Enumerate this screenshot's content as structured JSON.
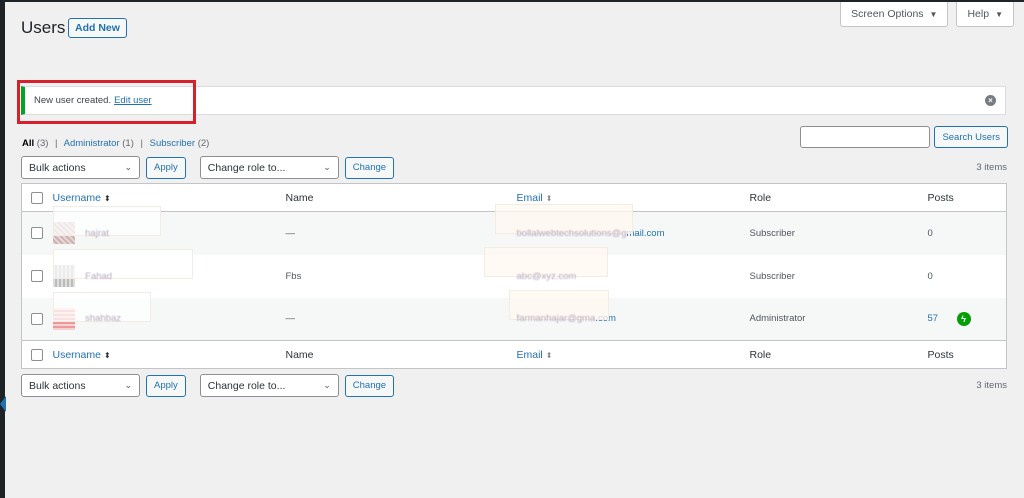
{
  "header": {
    "title": "Users",
    "add_new": "Add New"
  },
  "screen_meta": {
    "screen_options": "Screen Options",
    "help": "Help",
    "caret": "▼"
  },
  "notice": {
    "text": "New user created.",
    "link": "Edit user",
    "dismiss_icon": "×"
  },
  "filters": {
    "all": "All",
    "all_count": "(3)",
    "administrator": "Administrator",
    "administrator_count": "(1)",
    "subscriber": "Subscriber",
    "subscriber_count": "(2)",
    "separator": "|"
  },
  "search": {
    "button": "Search Users",
    "placeholder": ""
  },
  "tablenav": {
    "bulk_actions": "Bulk actions",
    "apply": "Apply",
    "change_role": "Change role to...",
    "change": "Change",
    "items_count": "3 items"
  },
  "table": {
    "columns": {
      "username": "Username",
      "name": "Name",
      "email": "Email",
      "role": "Role",
      "posts": "Posts"
    },
    "rows": [
      {
        "username": "hajrat",
        "name": "—",
        "email_visible": "om",
        "email_blurred": "bollalwebtechsolutions@g",
        "email_tail": "mail.com",
        "role": "Subscriber",
        "posts": "0"
      },
      {
        "username": "Fahad",
        "name": "Fbs",
        "email_visible": "",
        "email_blurred": "abc@xyz.com",
        "email_tail": "",
        "role": "Subscriber",
        "posts": "0"
      },
      {
        "username": "shahbaz",
        "name": "—",
        "email_visible": "",
        "email_blurred": "farmanhajar@gma",
        "email_tail": ".com",
        "role": "Administrator",
        "posts": "57"
      }
    ]
  },
  "icons": {
    "jetpack": "jetpack-bolt-icon",
    "sort": "⬍",
    "chevron": "⌄"
  },
  "colors": {
    "accent": "#2271b1",
    "notice_success": "#00a32a",
    "highlight": "#d6202b",
    "jetpack": "#069e08"
  }
}
